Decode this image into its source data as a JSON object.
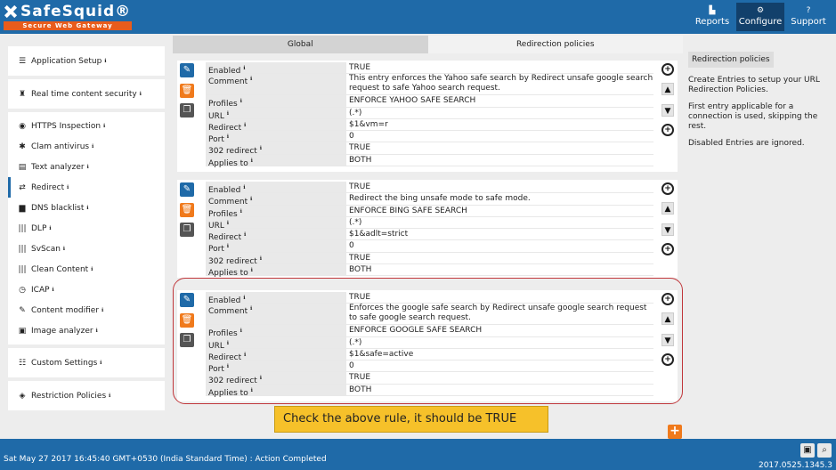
{
  "brand": {
    "name": "SafeSquid®",
    "tagline": "Secure Web Gateway"
  },
  "topnav": [
    {
      "label": "Reports",
      "icon": "bar-chart-icon"
    },
    {
      "label": "Configure",
      "icon": "cogs-icon",
      "active": true
    },
    {
      "label": "Support",
      "icon": "question-icon"
    }
  ],
  "sidebar": {
    "app_setup": "Application Setup",
    "rtcs": "Real time content security",
    "items": [
      {
        "label": "HTTPS Inspection"
      },
      {
        "label": "Clam antivirus"
      },
      {
        "label": "Text analyzer"
      },
      {
        "label": "Redirect",
        "selected": true
      },
      {
        "label": "DNS blacklist"
      },
      {
        "label": "DLP"
      },
      {
        "label": "SvScan"
      },
      {
        "label": "Clean Content"
      },
      {
        "label": "ICAP"
      },
      {
        "label": "Content modifier"
      },
      {
        "label": "Image analyzer"
      }
    ],
    "custom": "Custom Settings",
    "restriction": "Restriction Policies"
  },
  "tabs": {
    "global": "Global",
    "redirection": "Redirection policies"
  },
  "field_labels": {
    "enabled": "Enabled",
    "comment": "Comment",
    "profiles": "Profiles",
    "url": "URL",
    "redirect": "Redirect",
    "port": "Port",
    "redirect302": "302 redirect",
    "applies_to": "Applies to"
  },
  "entries": [
    {
      "enabled": "TRUE",
      "comment": "This entry enforces the Yahoo safe search by Redirect unsafe google search request to safe Yahoo search request.",
      "profiles": "ENFORCE YAHOO SAFE SEARCH",
      "url": "(.*)",
      "redirect": "$1&vm=r",
      "port": "0",
      "redirect302": "TRUE",
      "applies_to": "BOTH"
    },
    {
      "enabled": "TRUE",
      "comment": "Redirect the bing unsafe mode to safe mode.",
      "profiles": "ENFORCE BING SAFE SEARCH",
      "url": "(.*)",
      "redirect": "$1&adlt=strict",
      "port": "0",
      "redirect302": "TRUE",
      "applies_to": "BOTH"
    },
    {
      "enabled": "TRUE",
      "comment": "Enforces the google safe search by Redirect unsafe google search request to safe google search request.",
      "profiles": "ENFORCE GOOGLE SAFE SEARCH",
      "url": "(.*)",
      "redirect": "$1&safe=active",
      "port": "0",
      "redirect302": "TRUE",
      "applies_to": "BOTH"
    }
  ],
  "callout": "Check the above rule, it should be TRUE",
  "help": {
    "title": "Redirection policies",
    "p1": "Create Entries to setup your URL Redirection Policies.",
    "p2": "First entry applicable for a connection is used, skipping the rest.",
    "p3": "Disabled Entries are ignored."
  },
  "footer": {
    "status": "Sat May 27 2017 16:45:40 GMT+0530 (India Standard Time) : Action Completed",
    "version": "2017.0525.1345.3"
  },
  "colors": {
    "header": "#1f6aa8",
    "accent": "#f07a1c",
    "callout": "#f6c12a",
    "highlight": "#c0373b"
  }
}
